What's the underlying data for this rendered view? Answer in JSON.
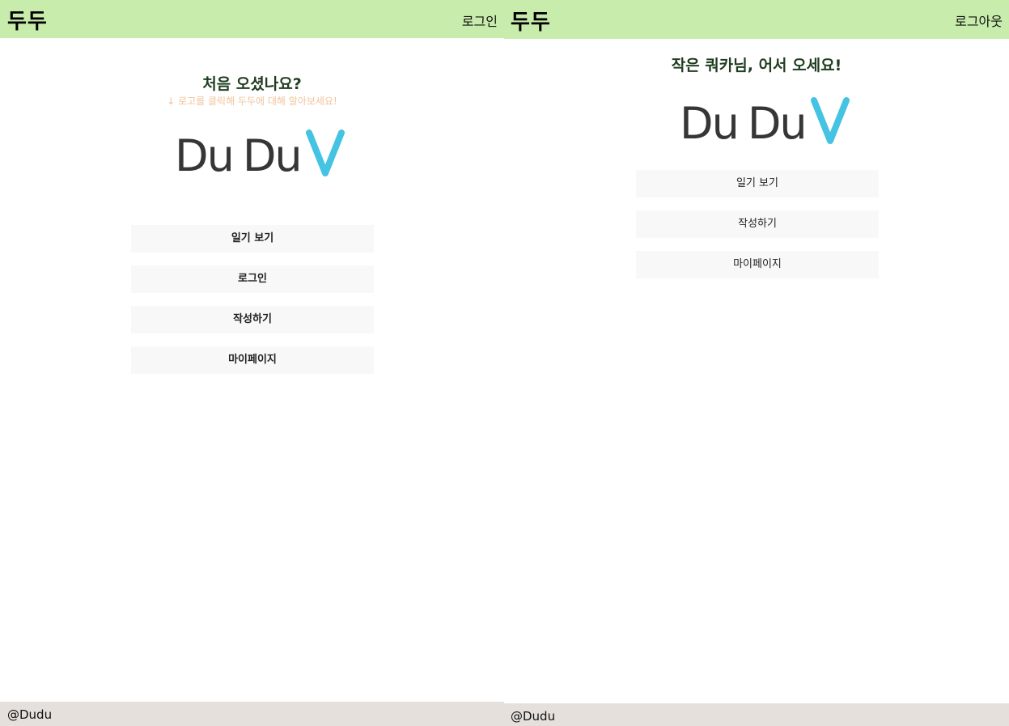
{
  "left_screen": {
    "header": {
      "brand": "두두",
      "auth_link": "로그인"
    },
    "welcome_title": "처음 오셨나요?",
    "hint": "↓ 로고를 클릭해 두두에 대해 알아보세요!",
    "logo": {
      "word1": "Du",
      "word2": "Du",
      "mark": "V"
    },
    "nav_buttons": [
      {
        "label": "일기 보기"
      },
      {
        "label": "로그인"
      },
      {
        "label": "작성하기"
      },
      {
        "label": "마이페이지"
      }
    ],
    "footer": {
      "text": "@Dudu"
    }
  },
  "right_screen": {
    "header": {
      "brand": "두두",
      "auth_link": "로그아웃"
    },
    "welcome_title": "작은 쿼카님, 어서 오세요!",
    "logo": {
      "word1": "Du",
      "word2": "Du",
      "mark": "V"
    },
    "nav_buttons": [
      {
        "label": "일기 보기"
      },
      {
        "label": "작성하기"
      },
      {
        "label": "마이페이지"
      }
    ],
    "footer": {
      "text": "@Dudu"
    }
  },
  "colors": {
    "header_bg": "#c7ecac",
    "footer_bg": "#e5e0dc",
    "button_bg": "#f8f8f8",
    "logo_text": "#363636",
    "logo_accent": "#45c3e3",
    "welcome_text": "#1f3d1f",
    "hint_text": "#f0c49b"
  }
}
